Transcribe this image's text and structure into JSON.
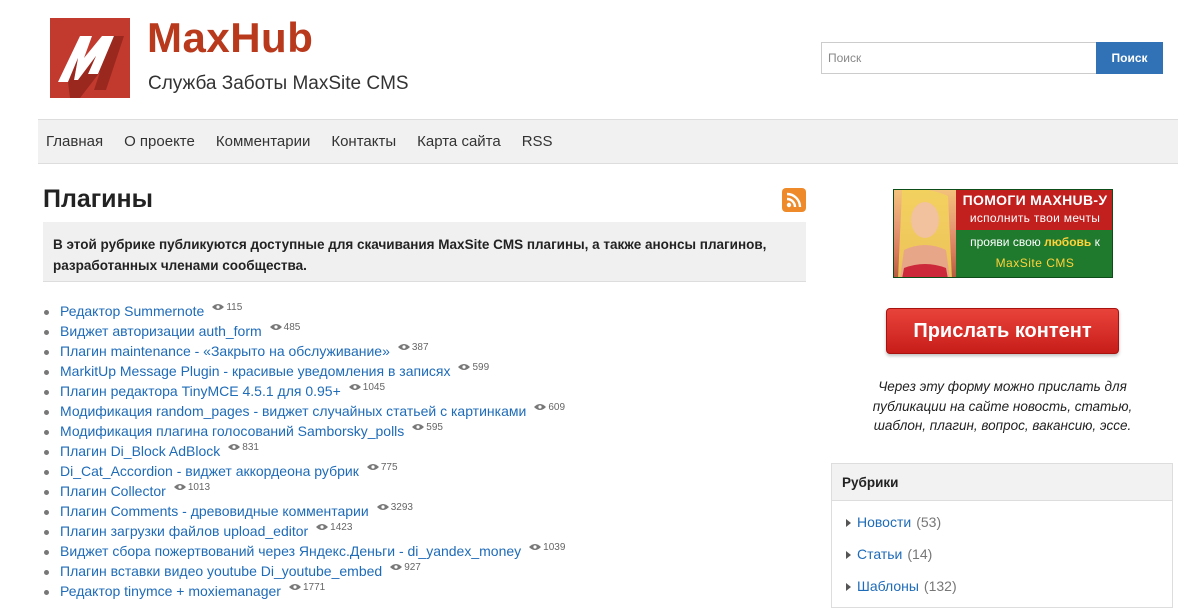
{
  "header": {
    "site_title": "MaxHub",
    "site_subtitle": "Служба Заботы MaxSite CMS",
    "search": {
      "placeholder": "Поиск",
      "button_label": "Поиск"
    },
    "colors": {
      "title": "#b8391c",
      "logo_bg": "#c23a2e",
      "search_button": "#3172b6"
    }
  },
  "nav": {
    "items": [
      "Главная",
      "О проекте",
      "Комментарии",
      "Контакты",
      "Карта сайта",
      "RSS"
    ]
  },
  "main": {
    "page_title": "Плагины",
    "rss_icon": "rss-feed-icon",
    "description": "В этой рубрике публикуются доступные для скачивания MaxSite CMS плагины, а также анонсы плагинов, разработанных членами сообщества.",
    "posts": [
      {
        "title": "Редактор Summernote",
        "views": "115"
      },
      {
        "title": "Виджет авторизации auth_form",
        "views": "485"
      },
      {
        "title": "Плагин maintenance - «Закрыто на обслуживание»",
        "views": "387"
      },
      {
        "title": "MarkitUp Message Plugin - красивые уведомления в записях",
        "views": "599"
      },
      {
        "title": "Плагин редактора TinyMCE 4.5.1 для 0.95+",
        "views": "1045"
      },
      {
        "title": "Модификация random_pages - виджет случайных статьей с картинками",
        "views": "609"
      },
      {
        "title": "Модификация плагина голосований Samborsky_polls",
        "views": "595"
      },
      {
        "title": "Плагин Di_Block AdBlock",
        "views": "831"
      },
      {
        "title": "Di_Cat_Accordion - виджет аккордеона рубрик",
        "views": "775"
      },
      {
        "title": "Плагин Collector",
        "views": "1013"
      },
      {
        "title": "Плагин Comments - древовидные комментарии",
        "views": "3293"
      },
      {
        "title": "Плагин загрузки файлов upload_editor",
        "views": "1423"
      },
      {
        "title": "Виджет сбора пожертвований через Яндекс.Деньги - di_yandex_money",
        "views": "1039"
      },
      {
        "title": "Плагин вставки видео youtube Di_youtube_embed",
        "views": "927"
      },
      {
        "title": "Редактор tinymce + moxiemanager",
        "views": "1771"
      }
    ]
  },
  "sidebar": {
    "banner": {
      "line1": "ПОМОГИ MAXHUB-У",
      "line2": "исполнить твои мечты",
      "line3_pre": "прояви свою",
      "line3_love": "любовь",
      "line3_post": "к",
      "line4": "MaxSite CMS"
    },
    "send_button": "Прислать контент",
    "send_note": "Через эту форму можно прислать для публикации на сайте новость, статью, шаблон, плагин, вопрос, вакансию, эссе.",
    "rubrics": {
      "title": "Рубрики",
      "items": [
        {
          "label": "Новости",
          "count": "(53)"
        },
        {
          "label": "Статьи",
          "count": "(14)"
        },
        {
          "label": "Шаблоны",
          "count": "(132)"
        }
      ]
    }
  }
}
